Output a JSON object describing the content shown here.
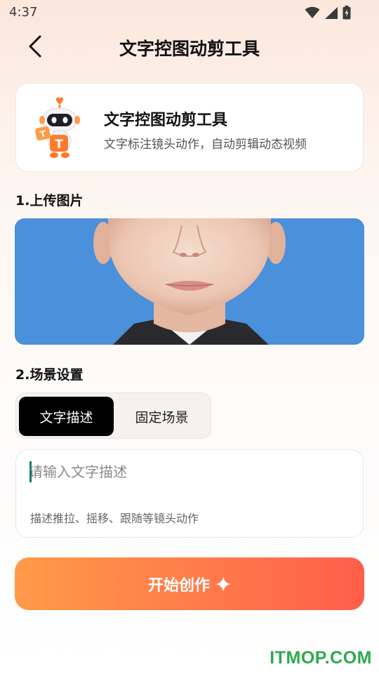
{
  "status_bar": {
    "time": "4:37",
    "icons": [
      "wifi-icon",
      "signal-icon",
      "battery-icon"
    ]
  },
  "header": {
    "title": "文字控图动剪工具",
    "back_icon": "chevron-left-icon"
  },
  "intro": {
    "title": "文字控图动剪工具",
    "subtitle": "文字标注镜头动作，自动剪辑动态视频",
    "mascot_icon": "robot-mascot-icon",
    "mascot_letter": "T"
  },
  "upload": {
    "label": "1.上传图片"
  },
  "scene": {
    "label": "2.场景设置",
    "tabs": [
      {
        "label": "文字描述",
        "active": true
      },
      {
        "label": "固定场景",
        "active": false
      }
    ]
  },
  "description": {
    "placeholder": "请输入文字描述",
    "value": "",
    "hint": "描述推拉、摇移、跟随等镜头动作"
  },
  "start_button": {
    "label": "开始创作",
    "icon": "sparkle-icon"
  },
  "watermark": "ITMOP.COM",
  "colors": {
    "accent_start": "#ff9a48",
    "accent_end": "#ff5e4a",
    "photo_background": "#4a90db",
    "active_tab": "#000000",
    "watermark": "#2da94f"
  }
}
